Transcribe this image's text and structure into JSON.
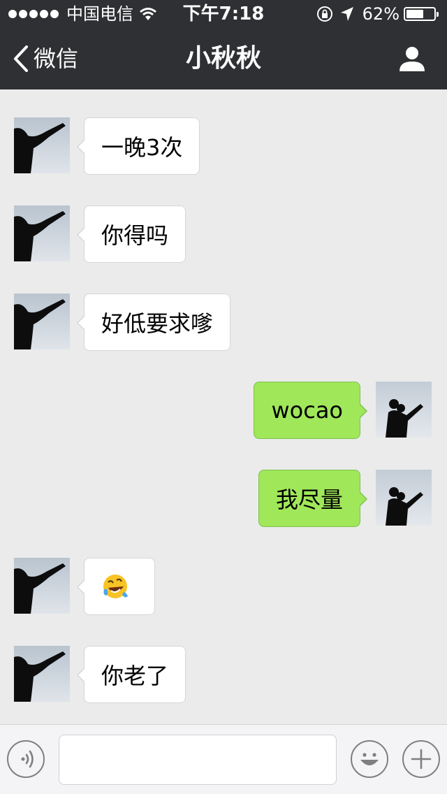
{
  "status_bar": {
    "carrier": "中国电信",
    "time": "下午7:18",
    "battery": "62%",
    "battery_level": 0.62,
    "icons": [
      "signal-dots-icon",
      "wifi-icon",
      "orientation-lock-icon",
      "location-arrow-icon",
      "battery-icon"
    ]
  },
  "nav": {
    "back_label": "微信",
    "title": "小秋秋",
    "profile_icon": "person-icon"
  },
  "messages": [
    {
      "side": "left",
      "type": "text",
      "text": "一晚3次"
    },
    {
      "side": "left",
      "type": "text",
      "text": "你得吗"
    },
    {
      "side": "left",
      "type": "text",
      "text": "好低要求嗲"
    },
    {
      "side": "right",
      "type": "text",
      "text": "wocao"
    },
    {
      "side": "right",
      "type": "text",
      "text": "我尽量"
    },
    {
      "side": "left",
      "type": "emoji",
      "text": "",
      "emoji": "rolling-on-floor-laughing-emoji"
    },
    {
      "side": "left",
      "type": "text",
      "text": "你老了"
    }
  ],
  "input_bar": {
    "value": "",
    "placeholder": "",
    "icons": [
      "voice-icon",
      "smiley-icon",
      "plus-icon"
    ]
  },
  "colors": {
    "header_bg": "#2e3033",
    "chat_bg": "#ebebeb",
    "sent_bubble": "#a0e75a",
    "received_bubble": "#ffffff"
  }
}
